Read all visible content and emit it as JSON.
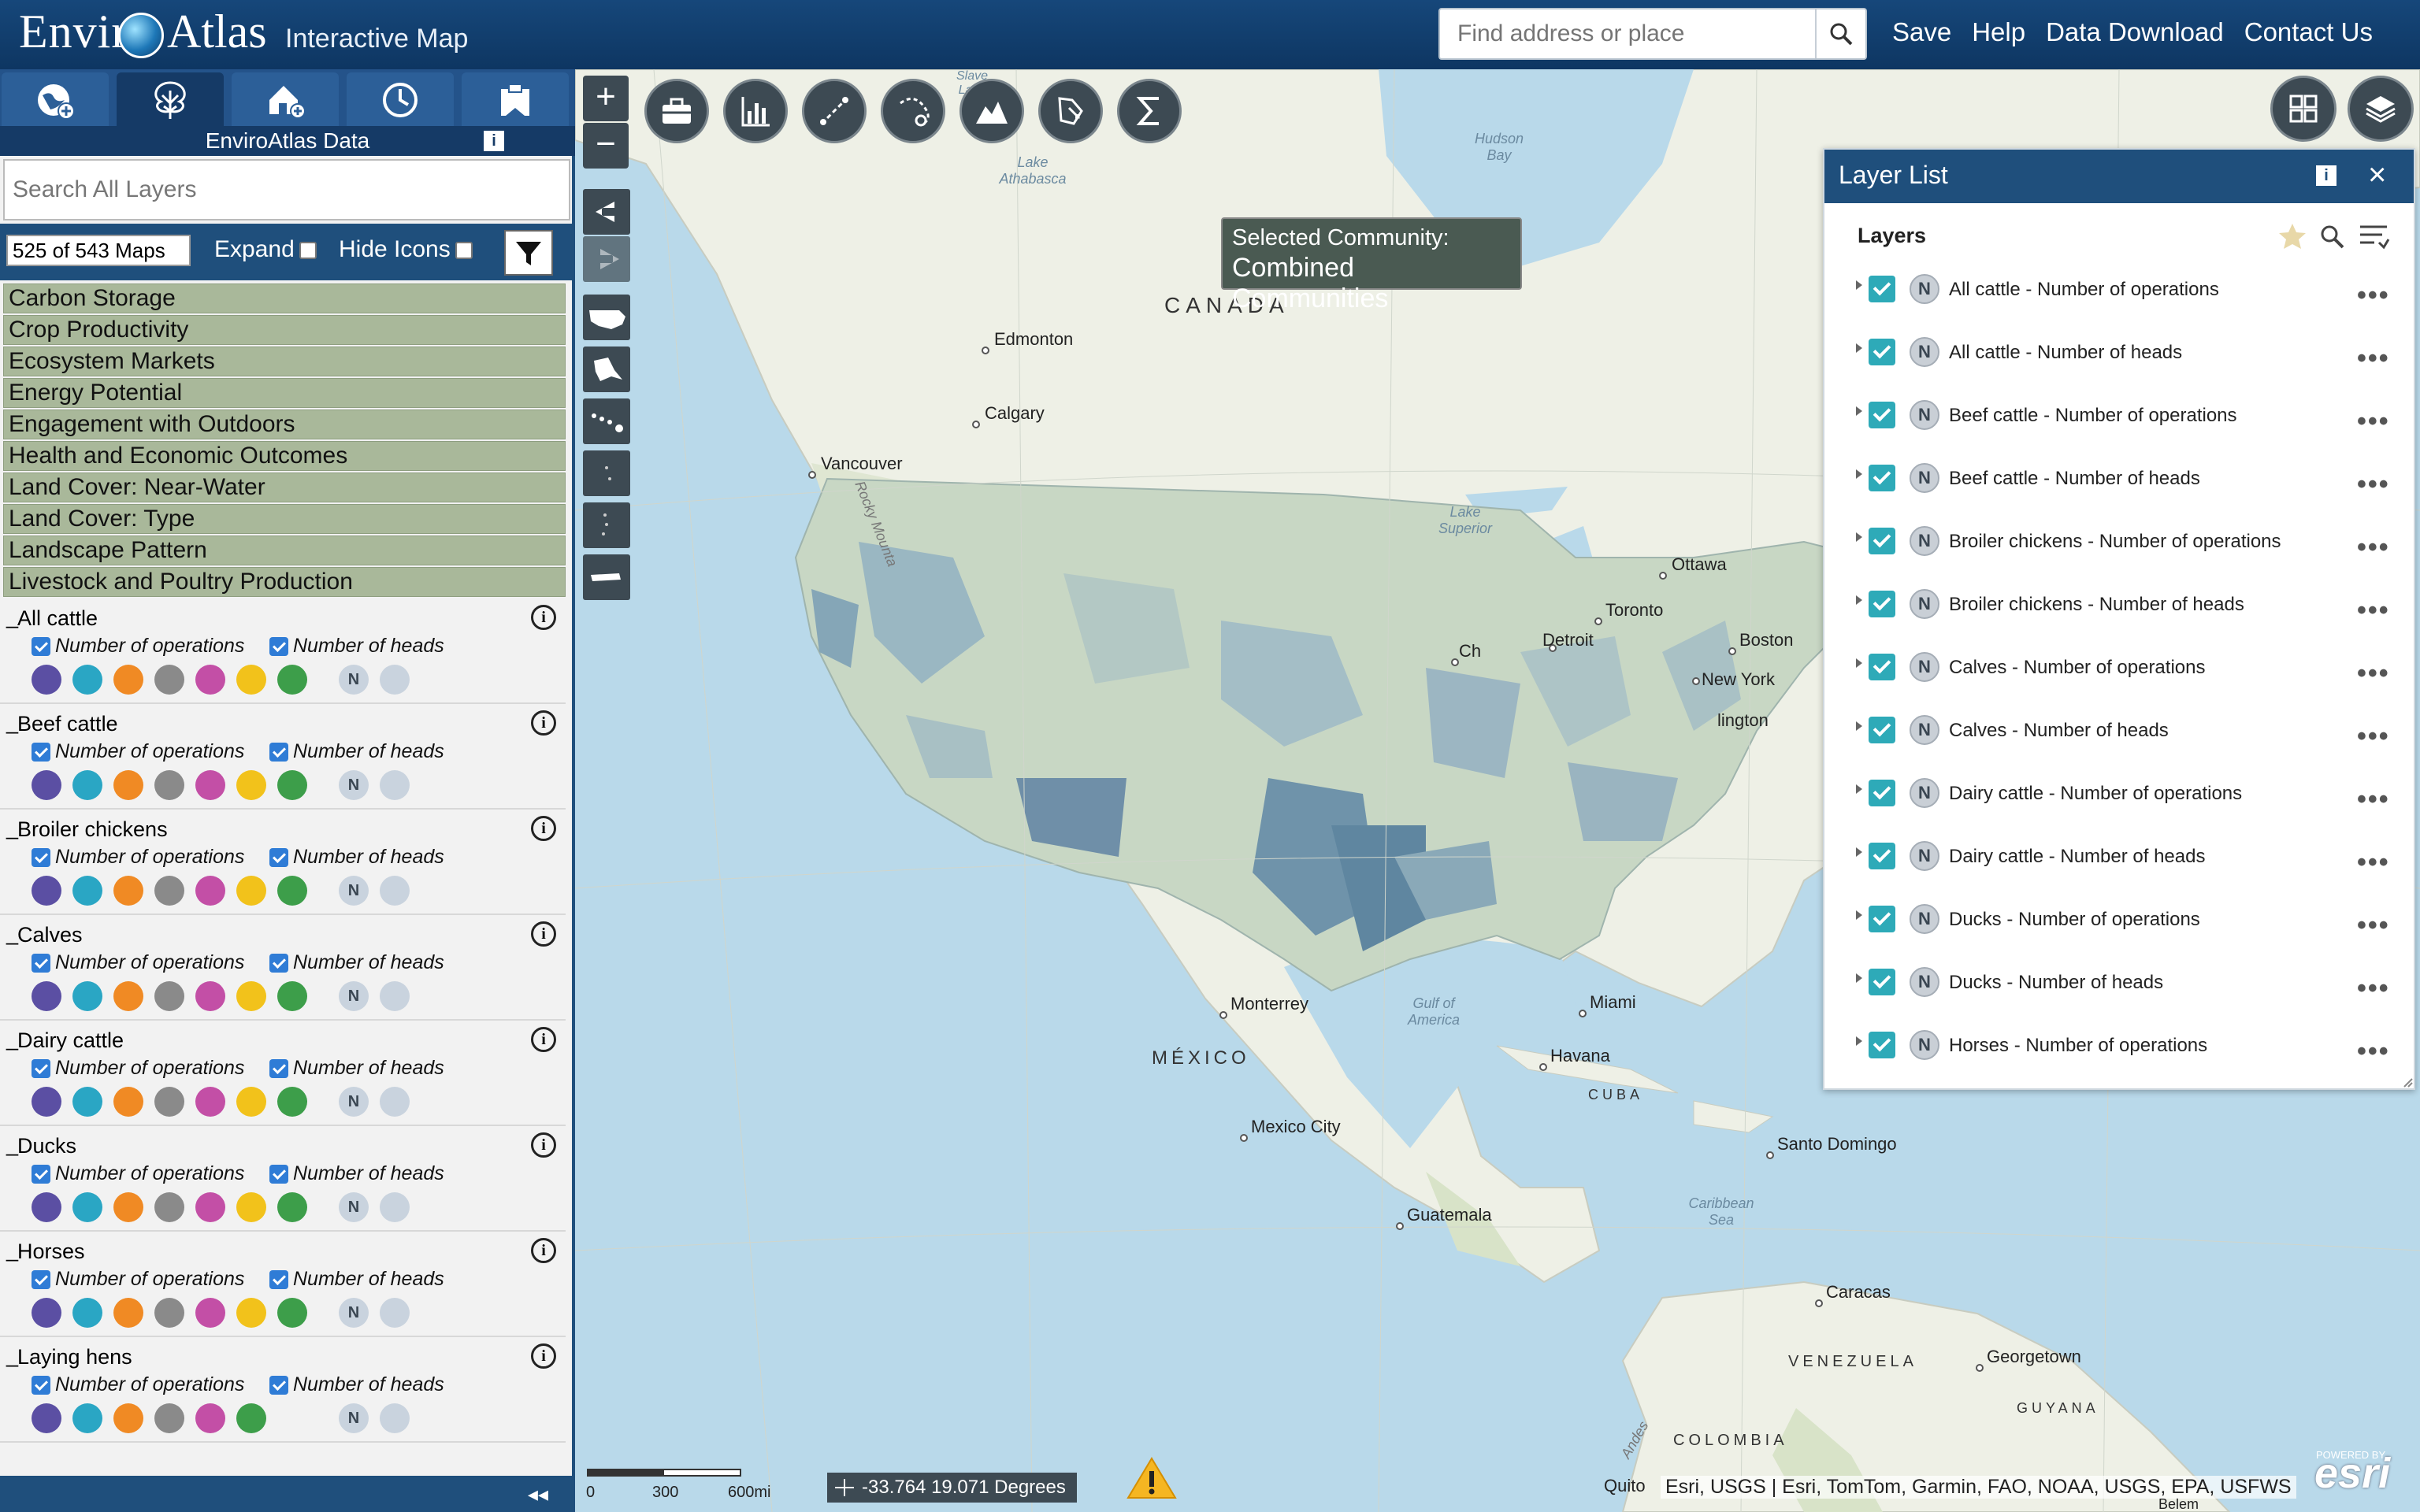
{
  "header": {
    "logo_left": "Envir",
    "logo_right": "Atlas",
    "subtitle": "Interactive Map",
    "search_placeholder": "Find address or place",
    "nav": [
      "Save",
      "Help",
      "Data Download",
      "Contact Us"
    ]
  },
  "left_panel": {
    "tab_caption": "EnviroAtlas Data",
    "tab_icons": [
      "globe-add-icon",
      "tree-icon",
      "house-add-icon",
      "clock-icon",
      "clipboard-icon"
    ],
    "layer_search_placeholder": "Search All Layers",
    "map_count": "525 of 543 Maps",
    "expand_label": "Expand",
    "hide_icons_label": "Hide Icons",
    "categories": [
      "Carbon Storage",
      "Crop Productivity",
      "Ecosystem Markets",
      "Energy Potential",
      "Engagement with Outdoors",
      "Health and Economic Outcomes",
      "Land Cover: Near-Water",
      "Land Cover: Type",
      "Landscape Pattern",
      "Livestock and Poultry Production"
    ],
    "groups": [
      {
        "title": "All cattle",
        "opt1": "Number of operations",
        "opt2": "Number of heads"
      },
      {
        "title": "Beef cattle",
        "opt1": "Number of operations",
        "opt2": "Number of heads"
      },
      {
        "title": "Broiler chickens",
        "opt1": "Number of operations",
        "opt2": "Number of heads"
      },
      {
        "title": "Calves",
        "opt1": "Number of operations",
        "opt2": "Number of heads"
      },
      {
        "title": "Dairy cattle",
        "opt1": "Number of operations",
        "opt2": "Number of heads"
      },
      {
        "title": "Ducks",
        "opt1": "Number of operations",
        "opt2": "Number of heads"
      },
      {
        "title": "Horses",
        "opt1": "Number of operations",
        "opt2": "Number of heads"
      },
      {
        "title": "Laying hens",
        "opt1": "Number of operations",
        "opt2": "Number of heads"
      }
    ],
    "service_icon_colors": [
      "#5b4fa3",
      "#2aa6c4",
      "#f08a24",
      "#8a8a8a",
      "#c34fa6",
      "#f2c21b",
      "#3d9e4a"
    ]
  },
  "map": {
    "selected_community_label": "Selected Community:",
    "selected_community_value": "Combined Communities",
    "labels": {
      "canada": "CANADA",
      "mexico": "MÉXICO",
      "cuba": "CUBA",
      "venezuela": "VENEZUELA",
      "colombia": "COLOMBIA",
      "guyana": "GUYANA",
      "hudson_bay": "Hudson Bay",
      "lake_athabasca": "Lake Athabasca",
      "slave_lake": "Slave Lake",
      "lake_superior": "Lake Superior",
      "gulf_of_mexico": "Gulf of America",
      "caribbean_sea": "Caribbean Sea",
      "rocky_mountains": "Rocky Mounta",
      "andes": "Andes"
    },
    "cities": [
      "Edmonton",
      "Calgary",
      "Vancouver",
      "Ottawa",
      "Toronto",
      "Boston",
      "New York",
      "Detroit",
      "Ch",
      "lington",
      "Monterrey",
      "Miami",
      "Havana",
      "Mexico City",
      "Santo Domingo",
      "Guatemala",
      "Caracas",
      "Georgetown",
      "Quito",
      "Belem"
    ],
    "scale_ticks": [
      "0",
      "300",
      "600mi"
    ],
    "coordinates": "-33.764 19.071 Degrees",
    "attribution": "Esri, USGS | Esri, TomTom, Garmin, FAO, NOAA, USGS, EPA, USFWS",
    "esri_powered": "POWERED BY",
    "esri_logo": "esri"
  },
  "layer_list": {
    "title": "Layer List",
    "section": "Layers",
    "badge": "N",
    "items": [
      "All cattle - Number of operations",
      "All cattle - Number of heads",
      "Beef cattle - Number of operations",
      "Beef cattle - Number of heads",
      "Broiler chickens - Number of operations",
      "Broiler chickens - Number of heads",
      "Calves - Number of operations",
      "Calves - Number of heads",
      "Dairy cattle - Number of operations",
      "Dairy cattle - Number of heads",
      "Ducks - Number of operations",
      "Ducks - Number of heads",
      "Horses - Number of operations"
    ]
  }
}
